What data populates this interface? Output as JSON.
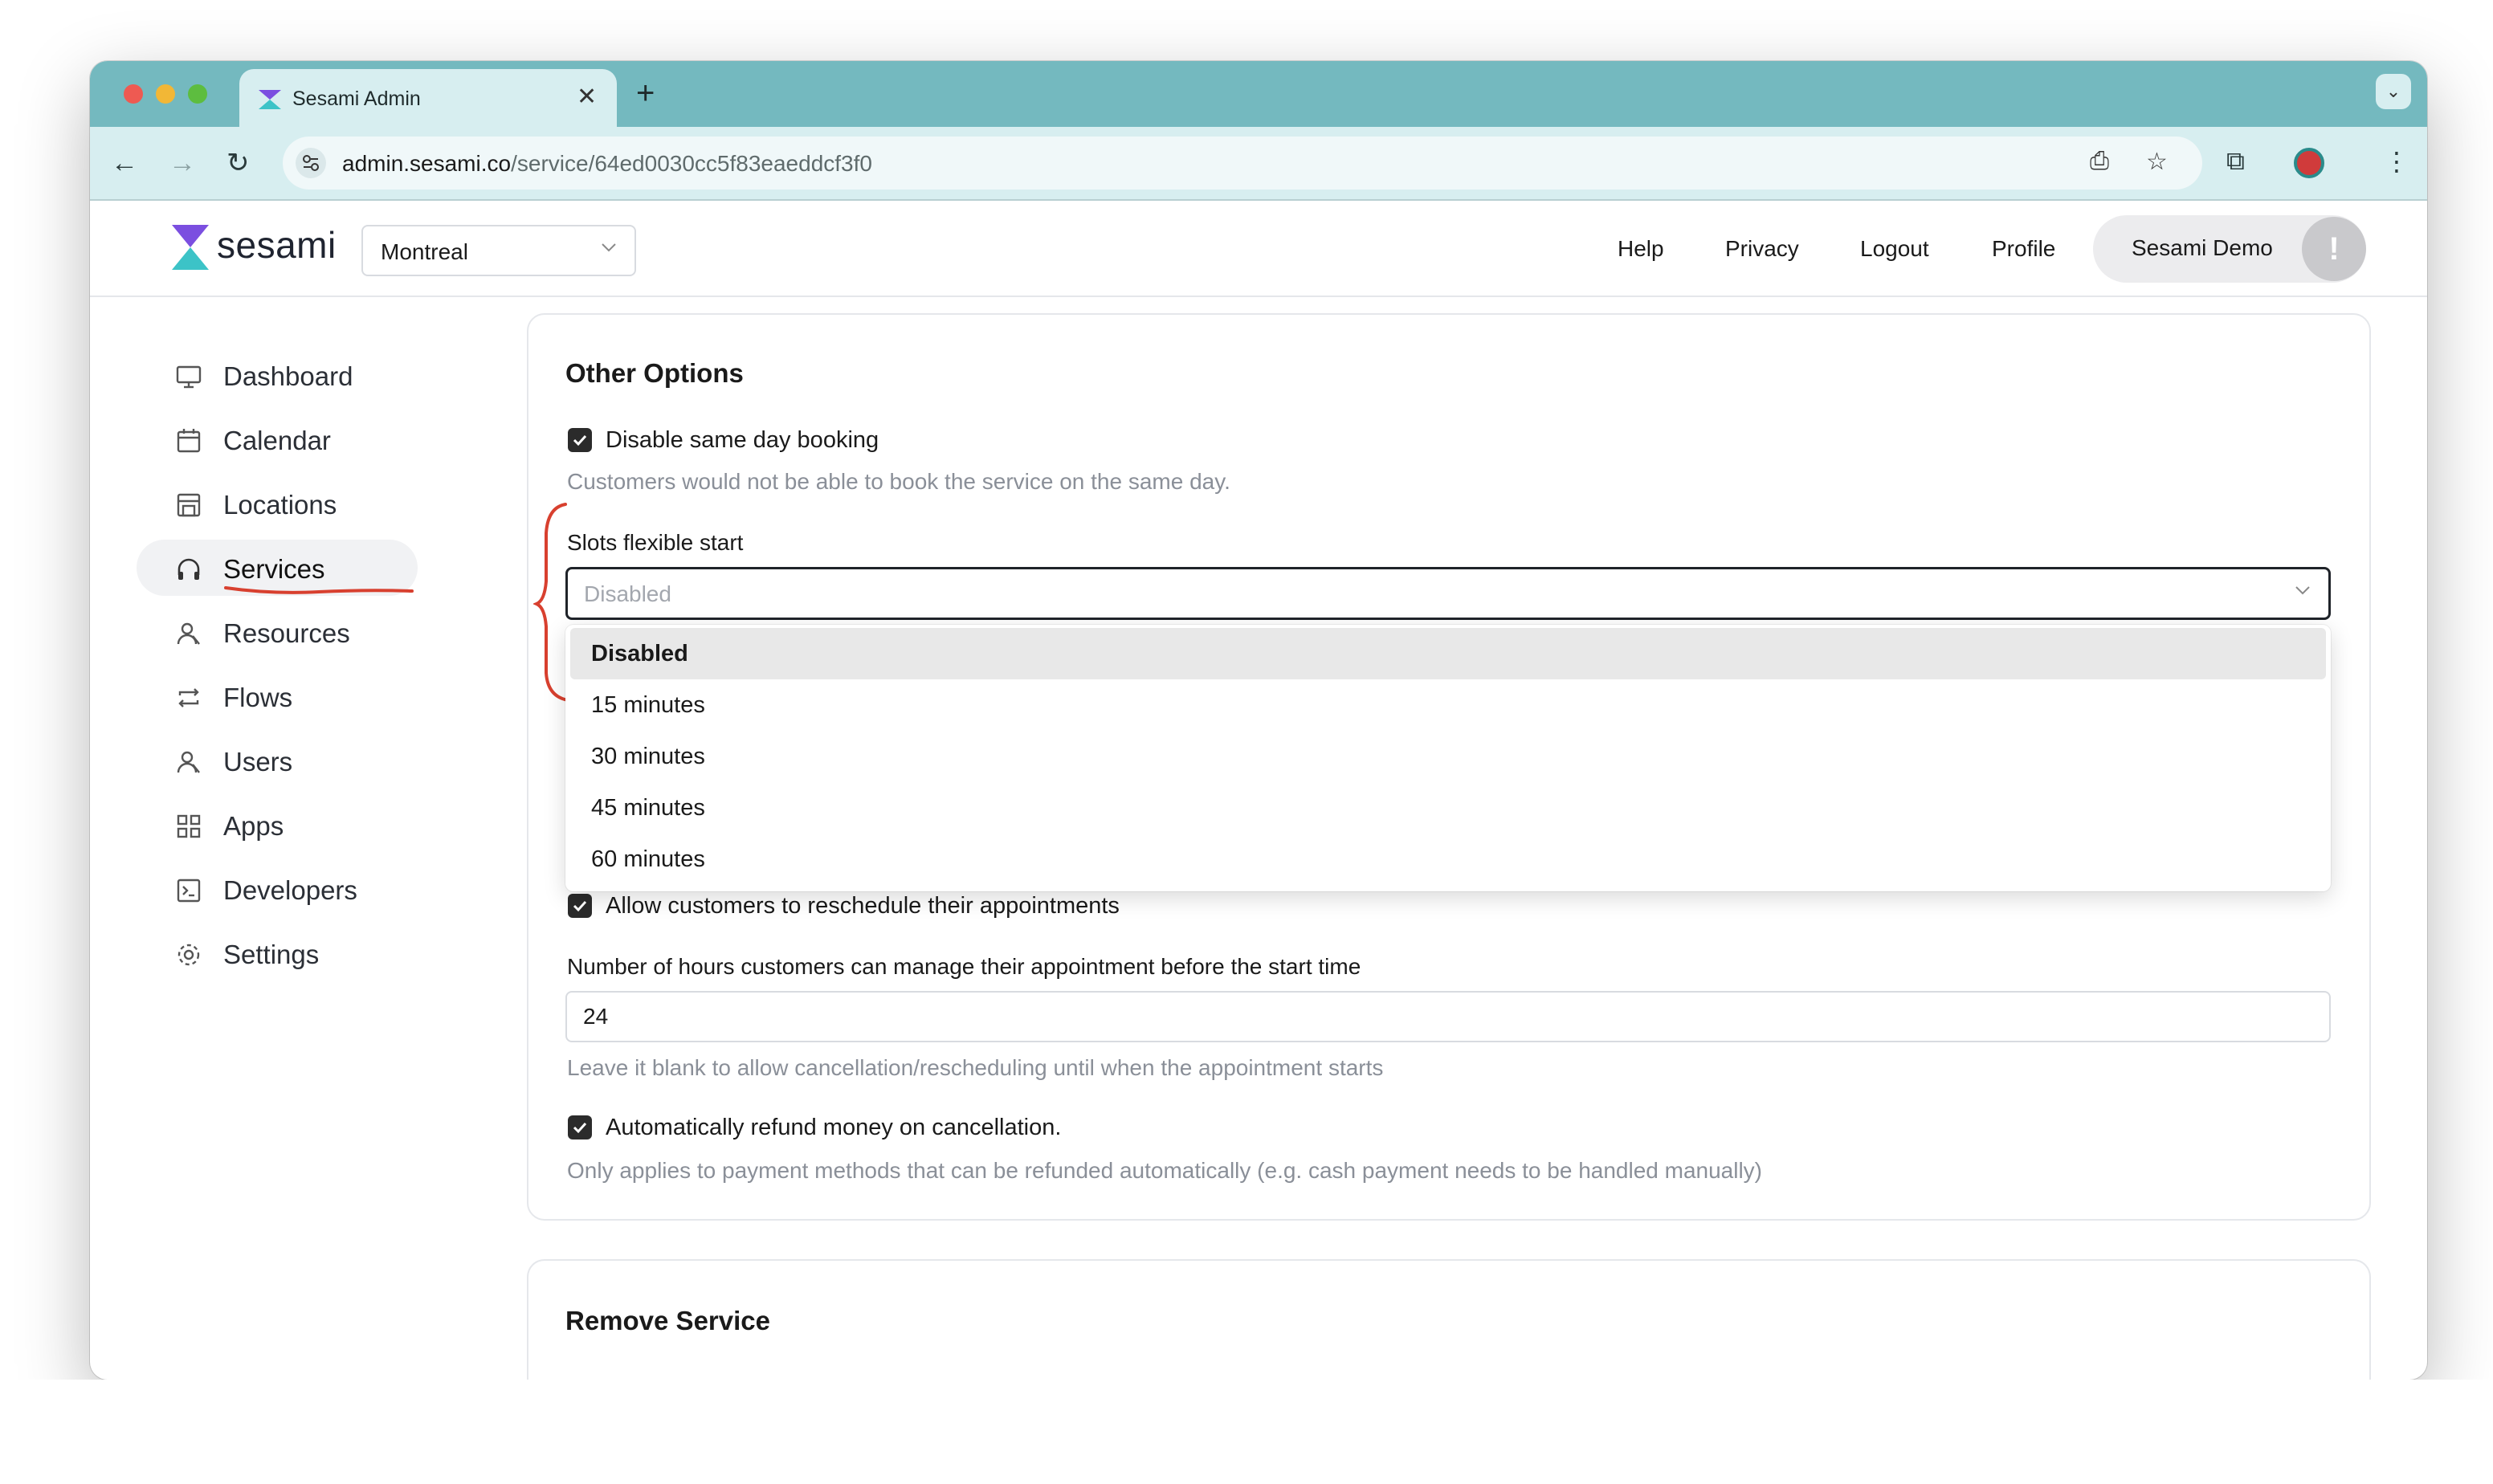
{
  "browser": {
    "tab_title": "Sesami Admin",
    "url_host": "admin.sesami.co",
    "url_path": "/service/64ed0030cc5f83eaeddcf3f0"
  },
  "header": {
    "logo_text": "sesami",
    "location_select": "Montreal",
    "links": [
      "Help",
      "Privacy",
      "Logout",
      "Profile"
    ],
    "user_name": "Sesami Demo",
    "user_alert": "!"
  },
  "sidebar": {
    "items": [
      {
        "label": "Dashboard",
        "icon": "monitor-icon"
      },
      {
        "label": "Calendar",
        "icon": "calendar-icon"
      },
      {
        "label": "Locations",
        "icon": "store-icon"
      },
      {
        "label": "Services",
        "icon": "headphones-icon",
        "active": true
      },
      {
        "label": "Resources",
        "icon": "user-icon"
      },
      {
        "label": "Flows",
        "icon": "repeat-icon"
      },
      {
        "label": "Users",
        "icon": "user-icon"
      },
      {
        "label": "Apps",
        "icon": "grid-icon"
      },
      {
        "label": "Developers",
        "icon": "terminal-icon"
      },
      {
        "label": "Settings",
        "icon": "gear-icon"
      }
    ]
  },
  "other_options": {
    "title": "Other Options",
    "disable_same_day": {
      "label": "Disable same day booking",
      "checked": true,
      "help": "Customers would not be able to book the service on the same day."
    },
    "slots_flexible_start": {
      "label": "Slots flexible start",
      "placeholder": "Disabled",
      "options": [
        "Disabled",
        "15 minutes",
        "30 minutes",
        "45 minutes",
        "60 minutes"
      ],
      "selected": "Disabled"
    },
    "allow_reschedule": {
      "label": "Allow customers to reschedule their appointments",
      "checked": true
    },
    "manage_hours": {
      "label": "Number of hours customers can manage their appointment before the start time",
      "value": "24",
      "help": "Leave it blank to allow cancellation/rescheduling until when the appointment starts"
    },
    "auto_refund": {
      "label": "Automatically refund money on cancellation.",
      "checked": true,
      "help": "Only applies to payment methods that can be refunded automatically (e.g. cash payment needs to be handled manually)"
    }
  },
  "remove_service": {
    "title": "Remove Service"
  },
  "colors": {
    "tab_bar": "#74b9bf",
    "toolbar": "#d7eef0",
    "annotation": "#d8402f",
    "logo_purple": "#7b4fe0",
    "logo_teal": "#3cc3c7"
  }
}
